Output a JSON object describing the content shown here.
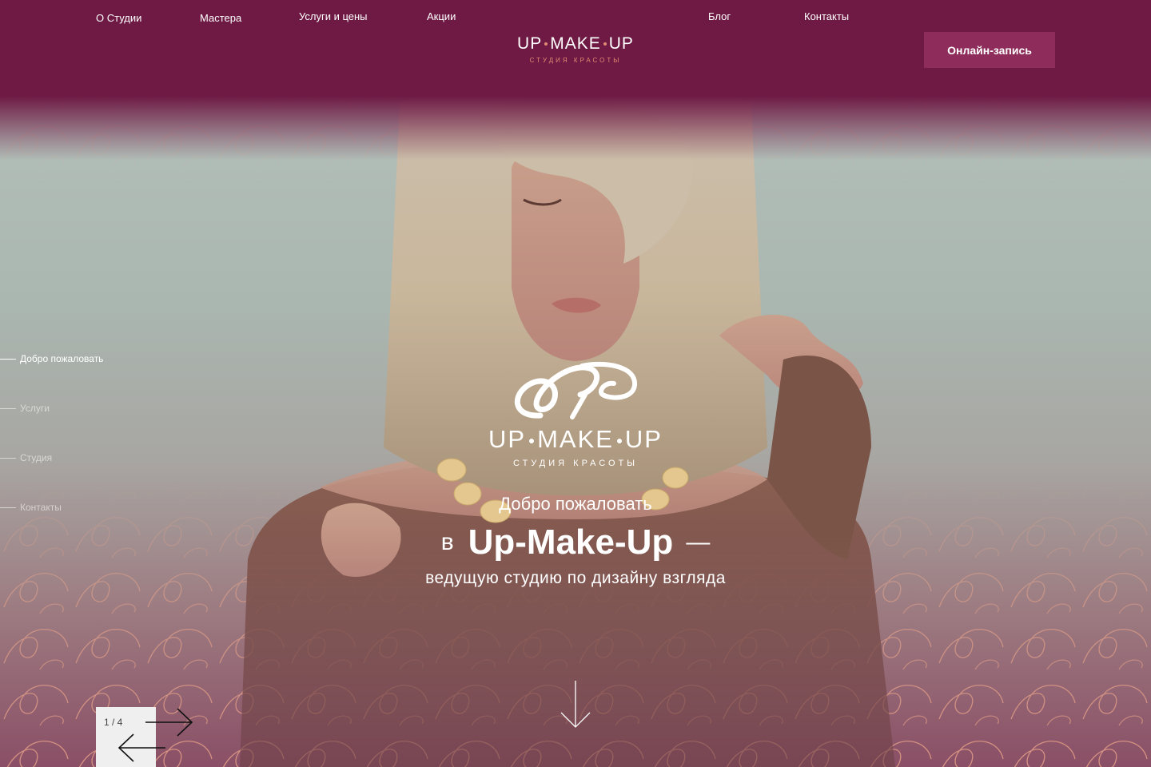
{
  "nav": {
    "items": [
      {
        "label": "О Студии"
      },
      {
        "label": "Мастера"
      },
      {
        "label": "Услуги и цены"
      },
      {
        "label": "Акции"
      },
      {
        "label": "Блог"
      },
      {
        "label": "Контакты"
      }
    ]
  },
  "brand": {
    "part1": "UP",
    "part2": "MAKE",
    "part3": "UP",
    "subtitle": "СТУДИЯ КРАСОТЫ"
  },
  "header": {
    "book_button": "Онлайн-запись"
  },
  "side_nav": {
    "items": [
      {
        "label": "Добро пожаловать",
        "active": true
      },
      {
        "label": "Услуги",
        "active": false
      },
      {
        "label": "Студия",
        "active": false
      },
      {
        "label": "Контакты",
        "active": false
      }
    ]
  },
  "hero": {
    "monogram_icon": "up-make-up-monogram-icon",
    "welcome": "Добро пожаловать",
    "pre": "в",
    "brand_text": "Up-Make-Up",
    "dash": "—",
    "tagline": "ведущую студию по дизайну взгляда",
    "scroll_icon": "arrow-down-icon"
  },
  "slider": {
    "counter": "1 / 4",
    "current": 1,
    "total": 4,
    "next_icon": "arrow-right-icon",
    "prev_icon": "arrow-left-icon"
  },
  "colors": {
    "primary": "#6e1a44",
    "button": "#8e2d5b",
    "accent": "#e28b73"
  }
}
